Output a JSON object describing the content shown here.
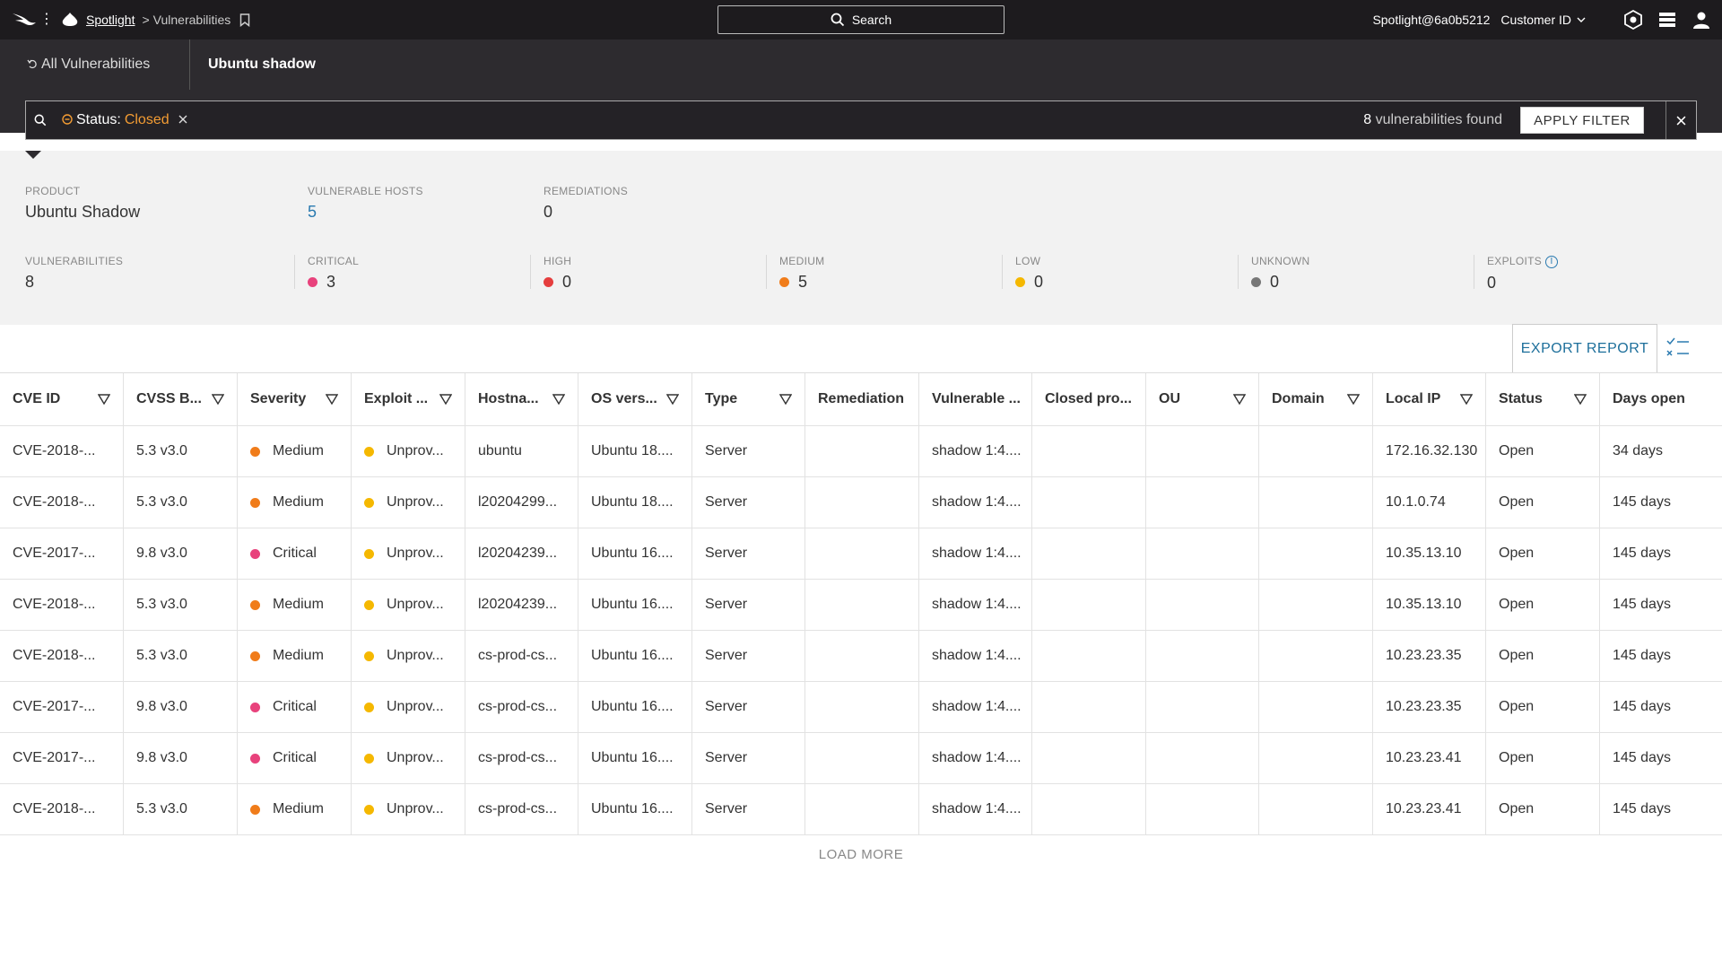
{
  "topbar": {
    "app_link": "Spotlight",
    "crumb_separator": ">",
    "page": "Vulnerabilities",
    "search_label": "Search",
    "user": "Spotlight@6a0b5212",
    "customer_id": "Customer ID"
  },
  "tabs": {
    "back_label": "All Vulnerabilities",
    "current": "Ubuntu shadow"
  },
  "filter": {
    "chip_key": "Status",
    "chip_sep": ":",
    "chip_value": "Closed",
    "found_count": "8",
    "found_text": " vulnerabilities found",
    "apply_label": "APPLY FILTER"
  },
  "summary": {
    "product_label": "PRODUCT",
    "product_value": "Ubuntu Shadow",
    "hosts_label": "VULNERABLE HOSTS",
    "hosts_value": "5",
    "remediations_label": "REMEDIATIONS",
    "remediations_value": "0",
    "vulns_label": "VULNERABILITIES",
    "vulns_value": "8",
    "critical_label": "CRITICAL",
    "critical_value": "3",
    "high_label": "HIGH",
    "high_value": "0",
    "medium_label": "MEDIUM",
    "medium_value": "5",
    "low_label": "LOW",
    "low_value": "0",
    "unknown_label": "UNKNOWN",
    "unknown_value": "0",
    "exploits_label": "EXPLOITS",
    "exploits_value": "0"
  },
  "colors": {
    "critical": "#e8427c",
    "high": "#e53e3e",
    "medium": "#f07c1a",
    "low": "#f5b800",
    "unknown": "#777777",
    "link": "#2a7ab0"
  },
  "toolbar": {
    "export_label": "EXPORT REPORT"
  },
  "table": {
    "headers": [
      "CVE ID",
      "CVSS B...",
      "Severity",
      "Exploit ...",
      "Hostna...",
      "OS vers...",
      "Type",
      "Remediation",
      "Vulnerable ...",
      "Closed pro...",
      "OU",
      "Domain",
      "Local IP",
      "Status",
      "Days open"
    ],
    "rows": [
      [
        "CVE-2018-...",
        "5.3 v3.0",
        "Medium",
        "Unprov...",
        "ubuntu",
        "Ubuntu 18....",
        "Server",
        "",
        "shadow 1:4....",
        "",
        "",
        "",
        "172.16.32.130",
        "Open",
        "34 days"
      ],
      [
        "CVE-2018-...",
        "5.3 v3.0",
        "Medium",
        "Unprov...",
        "l20204299...",
        "Ubuntu 18....",
        "Server",
        "",
        "shadow 1:4....",
        "",
        "",
        "",
        "10.1.0.74",
        "Open",
        "145 days"
      ],
      [
        "CVE-2017-...",
        "9.8 v3.0",
        "Critical",
        "Unprov...",
        "l20204239...",
        "Ubuntu 16....",
        "Server",
        "",
        "shadow 1:4....",
        "",
        "",
        "",
        "10.35.13.10",
        "Open",
        "145 days"
      ],
      [
        "CVE-2018-...",
        "5.3 v3.0",
        "Medium",
        "Unprov...",
        "l20204239...",
        "Ubuntu 16....",
        "Server",
        "",
        "shadow 1:4....",
        "",
        "",
        "",
        "10.35.13.10",
        "Open",
        "145 days"
      ],
      [
        "CVE-2018-...",
        "5.3 v3.0",
        "Medium",
        "Unprov...",
        "cs-prod-cs...",
        "Ubuntu 16....",
        "Server",
        "",
        "shadow 1:4....",
        "",
        "",
        "",
        "10.23.23.35",
        "Open",
        "145 days"
      ],
      [
        "CVE-2017-...",
        "9.8 v3.0",
        "Critical",
        "Unprov...",
        "cs-prod-cs...",
        "Ubuntu 16....",
        "Server",
        "",
        "shadow 1:4....",
        "",
        "",
        "",
        "10.23.23.35",
        "Open",
        "145 days"
      ],
      [
        "CVE-2017-...",
        "9.8 v3.0",
        "Critical",
        "Unprov...",
        "cs-prod-cs...",
        "Ubuntu 16....",
        "Server",
        "",
        "shadow 1:4....",
        "",
        "",
        "",
        "10.23.23.41",
        "Open",
        "145 days"
      ],
      [
        "CVE-2018-...",
        "5.3 v3.0",
        "Medium",
        "Unprov...",
        "cs-prod-cs...",
        "Ubuntu 16....",
        "Server",
        "",
        "shadow 1:4....",
        "",
        "",
        "",
        "10.23.23.41",
        "Open",
        "145 days"
      ]
    ],
    "load_more": "LOAD MORE"
  }
}
